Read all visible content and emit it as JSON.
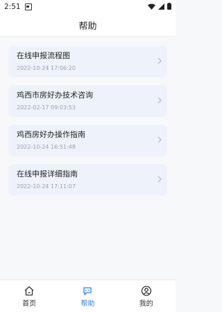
{
  "status": {
    "time": "2:51"
  },
  "header": {
    "title": "帮助"
  },
  "items": [
    {
      "title": "在线申报流程图",
      "date": "2022-10-24 17:06:20"
    },
    {
      "title": "鸡西市房好办技术咨询",
      "date": "2022-02-17 09:03:53"
    },
    {
      "title": "鸡西房好办操作指南",
      "date": "2022-10-24 16:51:48"
    },
    {
      "title": "在线申报详细指南",
      "date": "2022-10-24 17:11:07"
    }
  ],
  "tabs": [
    {
      "label": "首页",
      "icon": "home-icon"
    },
    {
      "label": "帮助",
      "icon": "help-icon",
      "active": true
    },
    {
      "label": "我的",
      "icon": "user-icon"
    }
  ],
  "colors": {
    "accent": "#2f7ee8",
    "card_bg": "#eef3fb",
    "page_bg": "#f7f8fa"
  }
}
